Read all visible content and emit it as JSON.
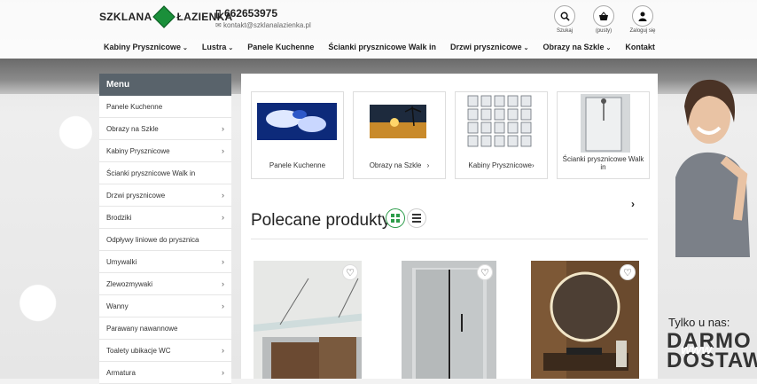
{
  "header": {
    "logo_left": "SZKLANA",
    "logo_right": "ŁAZIENKA",
    "phone": "662653975",
    "email": "kontakt@szklanalazienka.pl",
    "actions": [
      {
        "label": "Szukaj",
        "icon": "search-icon"
      },
      {
        "label": "(pusty)",
        "icon": "basket-icon"
      },
      {
        "label": "Zaloguj się",
        "icon": "user-icon"
      }
    ]
  },
  "nav": [
    {
      "label": "Kabiny Prysznicowe",
      "has_dropdown": true
    },
    {
      "label": "Lustra",
      "has_dropdown": true
    },
    {
      "label": "Panele Kuchenne",
      "has_dropdown": false
    },
    {
      "label": "Ścianki prysznicowe Walk in",
      "has_dropdown": false
    },
    {
      "label": "Drzwi prysznicowe",
      "has_dropdown": true
    },
    {
      "label": "Obrazy na Szkle",
      "has_dropdown": true
    },
    {
      "label": "Kontakt",
      "has_dropdown": false
    }
  ],
  "menu": {
    "title": "Menu",
    "items": [
      {
        "label": "Panele Kuchenne",
        "arrow": false
      },
      {
        "label": "Obrazy na Szkle",
        "arrow": true
      },
      {
        "label": "Kabiny Prysznicowe",
        "arrow": true
      },
      {
        "label": "Ścianki prysznicowe Walk in",
        "arrow": false
      },
      {
        "label": "Drzwi prysznicowe",
        "arrow": true
      },
      {
        "label": "Brodziki",
        "arrow": true
      },
      {
        "label": "Odpływy liniowe do prysznica",
        "arrow": false
      },
      {
        "label": "Umywalki",
        "arrow": true
      },
      {
        "label": "Zlewozmywaki",
        "arrow": true
      },
      {
        "label": "Wanny",
        "arrow": true
      },
      {
        "label": "Parawany nawannowe",
        "arrow": false
      },
      {
        "label": "Toalety ubikacje WC",
        "arrow": true
      },
      {
        "label": "Armatura",
        "arrow": true
      }
    ]
  },
  "categories": [
    {
      "label": "Panele Kuchenne"
    },
    {
      "label": "Obrazy na Szkle",
      "suffix": "›"
    },
    {
      "label": "Kabiny Prysznicowe›"
    },
    {
      "label": "Ścianki prysznicowe Walk in"
    }
  ],
  "section": {
    "title": "Polecane produkty"
  },
  "promo": {
    "tylko": "Tylko u nas:",
    "big": "DARMO",
    "big2": "DOSTAW",
    "www": "www"
  },
  "colors": {
    "menu_header": "#59636b",
    "accent_green": "#1a8f3a"
  }
}
